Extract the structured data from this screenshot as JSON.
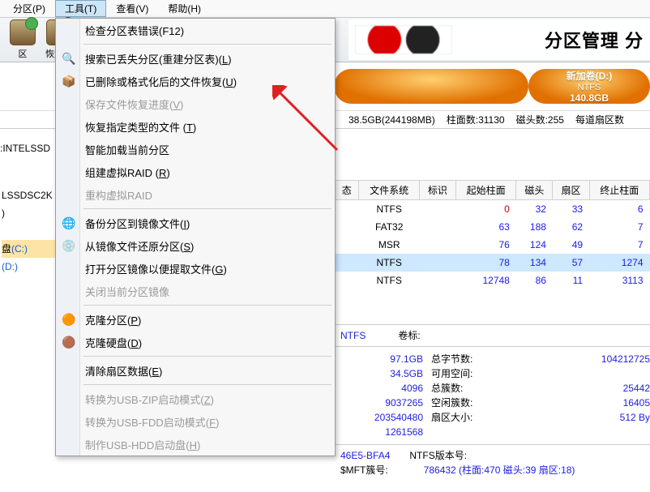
{
  "menubar": {
    "items": [
      "分区(P)",
      "工具(T)",
      "查看(V)",
      "帮助(H)"
    ],
    "open_index": 1
  },
  "toolbar": {
    "btn0_label": "区",
    "btn1_label": "恢复文"
  },
  "banner": {
    "title": "分区管理 分"
  },
  "diskbar": {
    "seg_right": {
      "line1": "新加卷(D:)",
      "line2": "NTFS",
      "line3": "140.8GB"
    }
  },
  "infoline": {
    "left": ":INTELSSD",
    "cap": "38.5GB(244198MB)",
    "cyl_label": "柱面数:",
    "cyl": "31130",
    "head_label": "磁头数:",
    "head": "255",
    "spt_label": "每道扇区数"
  },
  "left_tree": {
    "l0": "LSSDSC2K",
    "l1": ")",
    "l2_label": "盘",
    "l2_suffix": "(C:)",
    "l3": "(D:)"
  },
  "frag": {
    "a": "区 恢复文",
    "b": ":INTELSSD"
  },
  "table": {
    "headers": [
      "态",
      "文件系统",
      "标识",
      "起始柱面",
      "磁头",
      "扇区",
      "终止柱面"
    ],
    "rows": [
      {
        "fs": "NTFS",
        "flag": "",
        "c": "0",
        "h": "32",
        "s": "33",
        "ec": "6"
      },
      {
        "fs": "FAT32",
        "flag": "",
        "c": "63",
        "h": "188",
        "s": "62",
        "ec": "7"
      },
      {
        "fs": "MSR",
        "flag": "",
        "c": "76",
        "h": "124",
        "s": "49",
        "ec": "7"
      },
      {
        "fs": "NTFS",
        "flag": "",
        "c": "78",
        "h": "134",
        "s": "57",
        "ec": "1274",
        "sel": true
      },
      {
        "fs": "NTFS",
        "flag": "",
        "c": "12748",
        "h": "86",
        "s": "11",
        "ec": "3113"
      }
    ]
  },
  "detail": {
    "fs_label": "",
    "fs": "NTFS",
    "vol_label": "卷标:",
    "rows": [
      {
        "v": "97.1GB",
        "lbl": "总字节数:",
        "rv": "104212725"
      },
      {
        "v": "34.5GB",
        "lbl": "可用空间:",
        "rv": ""
      },
      {
        "v": "4096",
        "lbl": "总簇数:",
        "rv": "25442"
      },
      {
        "v": "9037265",
        "lbl": "空闲簇数:",
        "rv": "16405"
      },
      {
        "v": "203540480",
        "lbl": "扇区大小:",
        "rv": "512 By"
      },
      {
        "v": "1261568",
        "lbl": "",
        "rv": ""
      }
    ],
    "guid_frag": "46E5-BFA4",
    "ver_label": "NTFS版本号:",
    "mft_label": "$MFT簇号:",
    "mft_val": "786432 (柱面:470 磁头:39 扇区:18)"
  },
  "menu": {
    "items": [
      {
        "label": "检查分区表错误",
        "accel": "(F12)",
        "icon": ""
      },
      {
        "sep": true
      },
      {
        "label": "搜索已丢失分区(重建分区表)",
        "u": "L",
        "icon": "search"
      },
      {
        "label": "已删除或格式化后的文件恢复",
        "u": "U",
        "icon": "box"
      },
      {
        "label": "保存文件恢复进度",
        "u": "V",
        "disabled": true
      },
      {
        "label": "恢复指定类型的文件 ",
        "u": "T",
        "icon": ""
      },
      {
        "label": "智能加载当前分区",
        "icon": ""
      },
      {
        "label": "组建虚拟RAID ",
        "u": "R",
        "icon": ""
      },
      {
        "label": "重构虚拟RAID",
        "disabled": true
      },
      {
        "sep": true
      },
      {
        "label": "备份分区到镜像文件",
        "u": "I",
        "icon": "globe"
      },
      {
        "label": "从镜像文件还原分区",
        "u": "S",
        "icon": "globe2"
      },
      {
        "label": "打开分区镜像以便提取文件",
        "u": "G"
      },
      {
        "label": "关闭当前分区镜像",
        "disabled": true
      },
      {
        "sep": true
      },
      {
        "label": "克隆分区",
        "u": "P",
        "icon": "disc"
      },
      {
        "label": "克隆硬盘",
        "u": "D",
        "icon": "disc2"
      },
      {
        "sep": true
      },
      {
        "label": "清除扇区数据",
        "u": "E"
      },
      {
        "sep": true
      },
      {
        "label": "转换为USB-ZIP启动模式",
        "u": "Z",
        "disabled": true
      },
      {
        "label": "转换为USB-FDD启动模式",
        "u": "F",
        "disabled": true
      },
      {
        "label": "制作USB-HDD启动盘",
        "u": "H",
        "disabled": true
      }
    ]
  }
}
